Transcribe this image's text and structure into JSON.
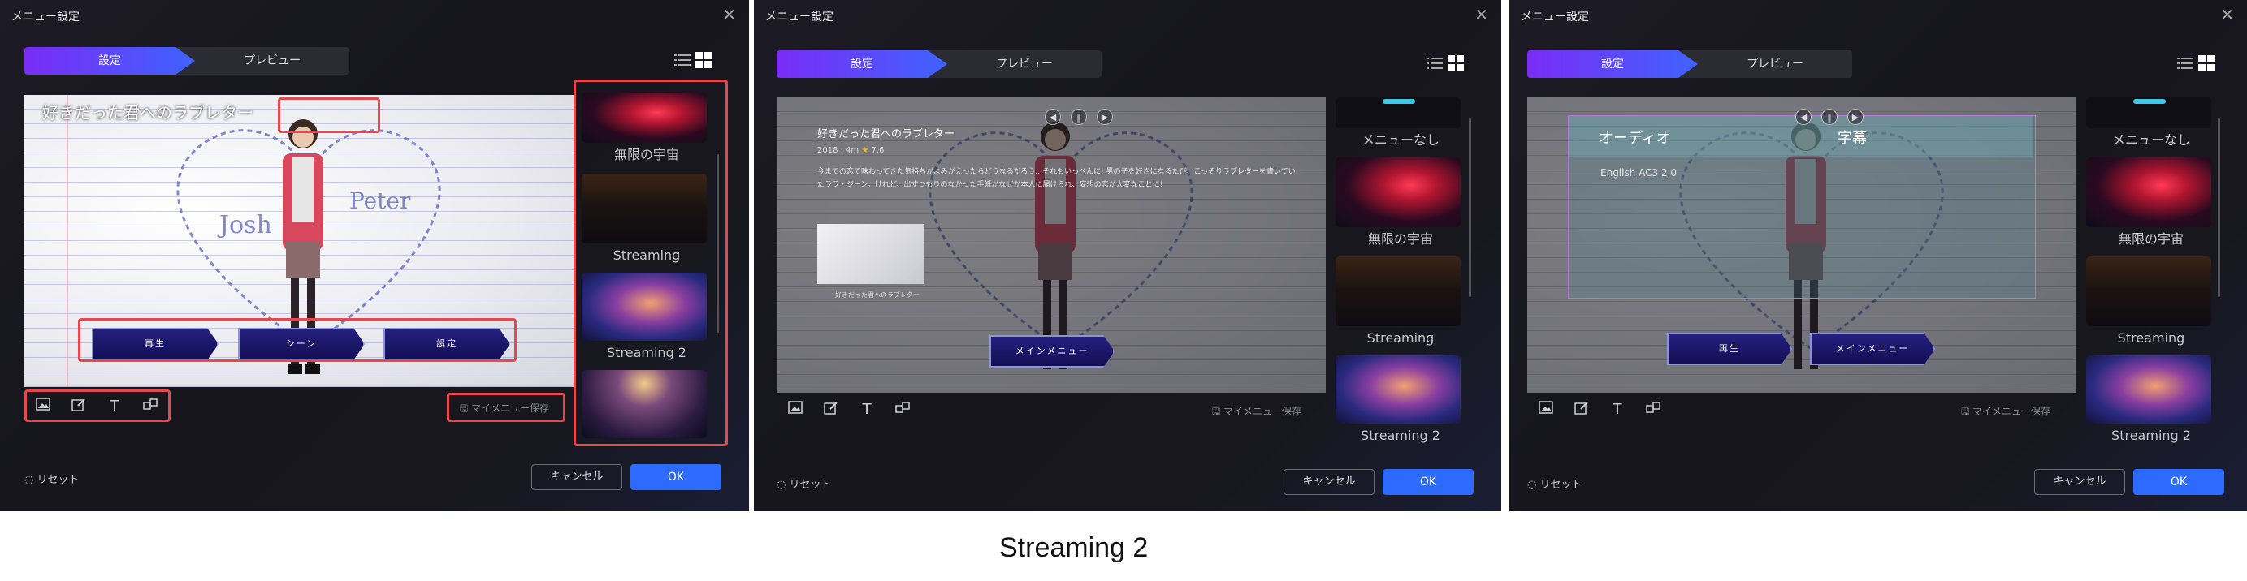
{
  "dialog_title": "メニュー設定",
  "tabs": {
    "settings": "設定",
    "preview": "プレビュー"
  },
  "movie_title": "好きだった君へのラブレター",
  "movie_year": "2018",
  "movie_duration": "4m",
  "movie_rating": "7.6",
  "movie_description": "今までの恋で味わってきた気持ちがよみがえったらどうなるだろう…それもいっぺんに! 男の子を好きになるたび、こっそりラブレターを書いていたララ・ジーン。けれど、出すつもりのなかった手紙がなぜか本人に届けられ、妄想の恋が大変なことに!",
  "menu_buttons": {
    "play": "再生",
    "scene": "シーン",
    "settings_jp": "設定",
    "main_menu": "メインメニュー"
  },
  "themes": {
    "space": "無限の宇宙",
    "streaming": "Streaming",
    "streaming2": "Streaming 2",
    "none": "メニューなし"
  },
  "audio": {
    "label": "オーディオ",
    "subtitle_label": "字幕",
    "track": "English AC3 2.0"
  },
  "my_menu_save": "マイメニュー保存",
  "reset": "リセット",
  "cancel": "キャンセル",
  "ok": "OK",
  "caption": "Streaming 2",
  "colors": {
    "accent_start": "#7a2cf5",
    "accent_end": "#3f63ff",
    "ok_blue": "#2d6bff",
    "highlight_red": "#e5484d"
  },
  "icons": [
    "close-icon",
    "list-view-icon",
    "grid-view-icon",
    "image-icon",
    "edit-icon",
    "text-icon",
    "layout-icon",
    "save-icon",
    "reset-icon",
    "star-icon"
  ]
}
